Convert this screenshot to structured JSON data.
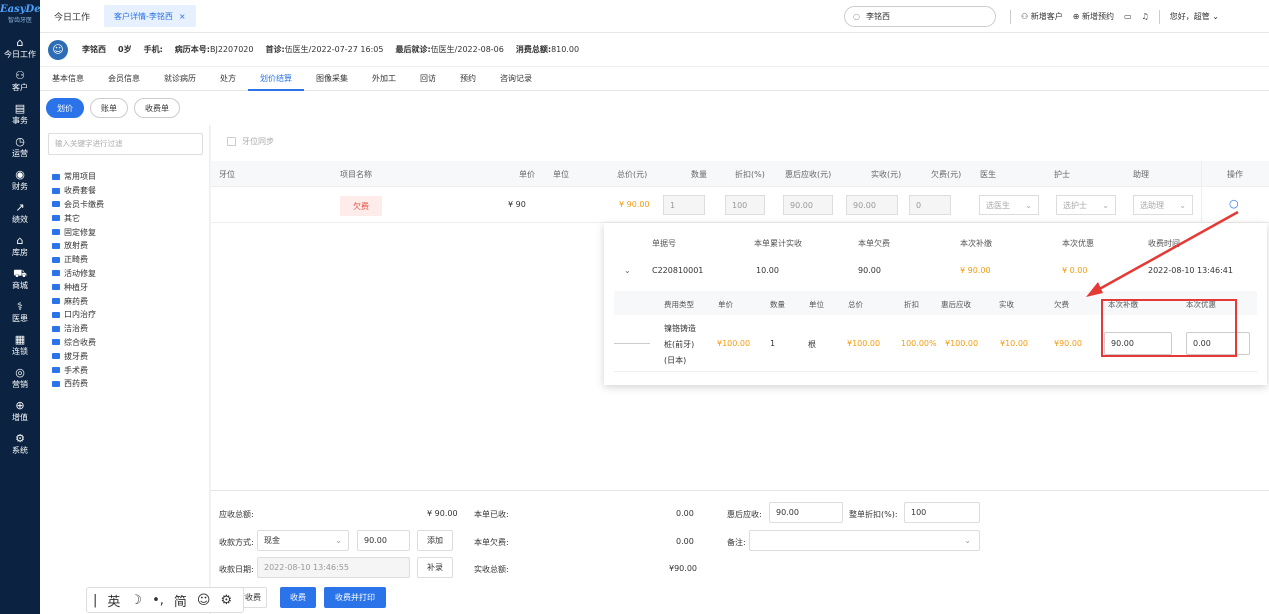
{
  "sidebar": {
    "logo_line1": "EasyDent",
    "logo_line2": "智齿牙医",
    "items": [
      {
        "icon": "⌂",
        "icon_name": "home-icon",
        "label": "今日工作"
      },
      {
        "icon": "⚇",
        "icon_name": "customer-icon",
        "label": "客户"
      },
      {
        "icon": "▤",
        "icon_name": "task-icon",
        "label": "事务"
      },
      {
        "icon": "◷",
        "icon_name": "operation-icon",
        "label": "运营"
      },
      {
        "icon": "◉",
        "icon_name": "finance-icon",
        "label": "财务"
      },
      {
        "icon": "↗",
        "icon_name": "performance-icon",
        "label": "绩效"
      },
      {
        "icon": "⌂",
        "icon_name": "warehouse-icon",
        "label": "库房"
      },
      {
        "icon": "⛟",
        "icon_name": "mall-icon",
        "label": "商城"
      },
      {
        "icon": "⚕",
        "icon_name": "doctor-icon",
        "label": "医患"
      },
      {
        "icon": "▦",
        "icon_name": "chain-icon",
        "label": "连锁"
      },
      {
        "icon": "◎",
        "icon_name": "marketing-icon",
        "label": "营销"
      },
      {
        "icon": "⊕",
        "icon_name": "value-added-icon",
        "label": "增值"
      },
      {
        "icon": "⚙",
        "icon_name": "settings-icon",
        "label": "系统"
      }
    ]
  },
  "topbar": {
    "home_tab": "今日工作",
    "active_tab": "客户详情-李铭西",
    "close": "×",
    "search_value": "李铭西",
    "new_customer": "新增客户",
    "new_appointment": "新增预约",
    "greeting": "您好，超管"
  },
  "patient": {
    "name": "李铭西",
    "age": "0岁",
    "phone_label": "手机:",
    "record_label": "病历本号:",
    "record_no": "BJ2207020",
    "first_visit_label": "首诊:",
    "first_visit": "伍医生/2022-07-27 16:05",
    "last_visit_label": "最后就诊:",
    "last_visit": "伍医生/2022-08-06",
    "total_label": "消费总额:",
    "total": "810.00"
  },
  "navtabs": [
    "基本信息",
    "会员信息",
    "就诊病历",
    "处方",
    "划价结算",
    "图像采集",
    "外加工",
    "回访",
    "预约",
    "咨询记录"
  ],
  "subtabs": [
    "划价",
    "账单",
    "收费单"
  ],
  "left": {
    "filter_placeholder": "输入关键字进行过滤",
    "tree": [
      "常用项目",
      "收费套餐",
      "会员卡缴费",
      "其它",
      "固定修复",
      "放射费",
      "正畸费",
      "活动修复",
      "种植牙",
      "麻药费",
      "口内治疗",
      "洁治费",
      "综合收费",
      "拔牙费",
      "手术费",
      "西药费"
    ]
  },
  "main": {
    "sync_label": "牙位同步",
    "headers": {
      "tooth": "牙位",
      "item": "项目名称",
      "price": "单价",
      "unit": "单位",
      "total": "总价(元)",
      "qty": "数量",
      "discount": "折扣(%)",
      "after": "惠后应收(元)",
      "paid": "实收(元)",
      "owed": "欠费(元)",
      "doctor": "医生",
      "nurse": "护士",
      "assistant": "助理",
      "op": "操作"
    },
    "row": {
      "item": "欠费",
      "price": "¥ 90",
      "total": "¥ 90.00",
      "qty": "1",
      "discount": "100",
      "after": "90.00",
      "paid": "90.00",
      "owed": "0",
      "doctor": "选医生",
      "nurse": "选护士",
      "assistant": "选助理"
    }
  },
  "popup": {
    "headers": [
      "单据号",
      "本单累计实收",
      "本单欠费",
      "本次补缴",
      "本次优惠",
      "收费时间"
    ],
    "values": {
      "no": "C220810001",
      "paid_total": "10.00",
      "owed": "90.00",
      "pay": "¥ 90.00",
      "discount": "¥ 0.00",
      "time": "2022-08-10 13:46:41"
    },
    "sub_headers": [
      "费用类型",
      "单价",
      "数量",
      "单位",
      "总价",
      "折扣",
      "惠后应收",
      "实收",
      "欠费",
      "本次补缴",
      "本次优惠"
    ],
    "sub_row": {
      "type_line1": "镍铬铸造",
      "type_line2": "桩(前牙)",
      "type_line3": "(日本)",
      "price": "¥100.00",
      "qty": "1",
      "unit": "根",
      "total": "¥100.00",
      "discount": "100.00%",
      "after": "¥100.00",
      "paid": "¥10.00",
      "owed": "¥90.00",
      "pay_input": "90.00",
      "discount_input": "0.00"
    }
  },
  "bottom": {
    "due_label": "应收总额:",
    "due": "¥ 90.00",
    "received_label": "本单已收:",
    "received": "0.00",
    "after_label": "惠后应收:",
    "after_value": "90.00",
    "whole_discount_label": "整单折扣(%):",
    "whole_discount": "100",
    "method_label": "收款方式:",
    "method": "现金",
    "method_amount": "90.00",
    "add_btn": "添加",
    "owed_label": "本单欠费:",
    "owed": "0.00",
    "remark_label": "备注:",
    "date_label": "收款日期:",
    "date": "2022-08-10 13:46:55",
    "supplement_btn": "补录",
    "actual_label": "实收总额:",
    "actual": "¥90.00",
    "btn_partial": "暂收费",
    "btn_charge": "收费",
    "btn_charge_print": "收费并打印"
  },
  "ime": {
    "cursor": "|",
    "lang": "英",
    "moon": "☽",
    "punct": "•,",
    "simp": "简",
    "emoji": "☺",
    "gear": "⚙"
  },
  "colors": {
    "accent": "#2a73e8",
    "sidebar": "#0b2340",
    "warning": "#e74c3c",
    "orange": "#f39c12"
  }
}
